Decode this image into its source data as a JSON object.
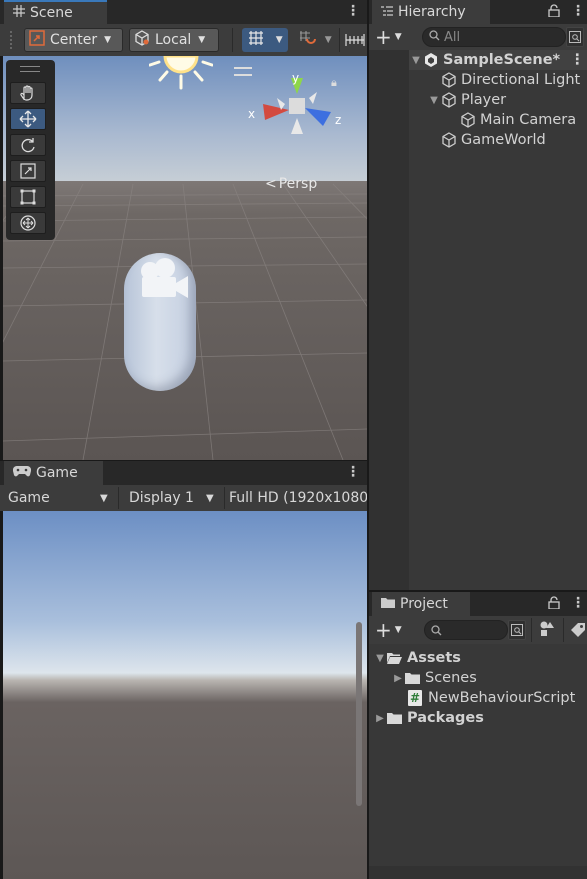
{
  "scene": {
    "tab_label": "Scene",
    "pivot_label": "Center",
    "space_label": "Local",
    "persp_label": "Persp",
    "gizmo_axes": {
      "x": "x",
      "y": "y",
      "z": "z"
    },
    "tools": [
      "hand-tool",
      "move-tool",
      "rotate-tool",
      "scale-tool",
      "rect-tool",
      "transform-tool"
    ],
    "active_tool": "move-tool"
  },
  "game": {
    "tab_label": "Game",
    "mode_label": "Game",
    "display_label": "Display 1",
    "resolution_label": "Full HD (1920x1080"
  },
  "hierarchy": {
    "tab_label": "Hierarchy",
    "search_placeholder": "All",
    "scene_name": "SampleScene*",
    "items": [
      {
        "label": "Directional Light"
      },
      {
        "label": "Player"
      },
      {
        "label": "Main Camera"
      },
      {
        "label": "GameWorld"
      }
    ]
  },
  "project": {
    "tab_label": "Project",
    "items": [
      {
        "label": "Assets"
      },
      {
        "label": "Scenes"
      },
      {
        "label": "NewBehaviourScript"
      },
      {
        "label": "Packages"
      }
    ]
  },
  "colors": {
    "accent_blue": "#3c5a80",
    "panel_bg": "#383838",
    "toolbar_bg": "#3c3c3c",
    "sky_top": "#6e8fbf",
    "ground": "#5d5755"
  }
}
